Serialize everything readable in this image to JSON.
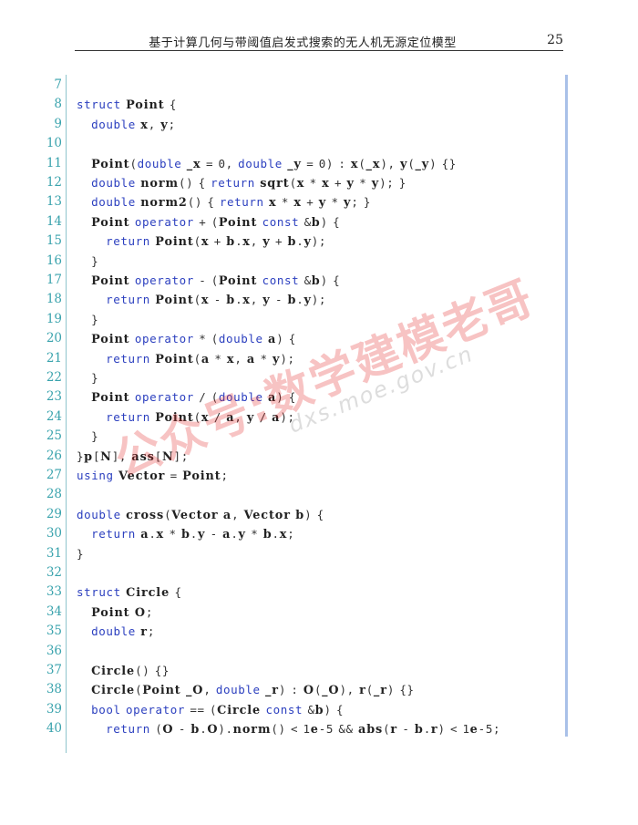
{
  "header": {
    "title": "基于计算几何与带阈值启发式搜索的无人机无源定位模型",
    "page_number": "25"
  },
  "code_lines": [
    {
      "n": "7",
      "text": ""
    },
    {
      "n": "8",
      "text": "struct Point {"
    },
    {
      "n": "9",
      "text": "   double x, y;"
    },
    {
      "n": "10",
      "text": ""
    },
    {
      "n": "11",
      "text": "   Point(double _x = 0, double _y = 0) : x(_x), y(_y) {}"
    },
    {
      "n": "12",
      "text": "   double norm() { return sqrt(x * x + y * y); }"
    },
    {
      "n": "13",
      "text": "   double norm2() { return x * x + y * y; }"
    },
    {
      "n": "14",
      "text": "   Point operator + (Point const &b) {"
    },
    {
      "n": "15",
      "text": "      return Point(x + b.x, y + b.y);"
    },
    {
      "n": "16",
      "text": "   }"
    },
    {
      "n": "17",
      "text": "   Point operator - (Point const &b) {"
    },
    {
      "n": "18",
      "text": "      return Point(x - b.x, y - b.y);"
    },
    {
      "n": "19",
      "text": "   }"
    },
    {
      "n": "20",
      "text": "   Point operator * (double a) {"
    },
    {
      "n": "21",
      "text": "      return Point(a * x, a * y);"
    },
    {
      "n": "22",
      "text": "   }"
    },
    {
      "n": "23",
      "text": "   Point operator / (double a) {"
    },
    {
      "n": "24",
      "text": "      return Point(x / a, y / a);"
    },
    {
      "n": "25",
      "text": "   }"
    },
    {
      "n": "26",
      "text": "}p[N], ass[N];"
    },
    {
      "n": "27",
      "text": "using Vector = Point;"
    },
    {
      "n": "28",
      "text": ""
    },
    {
      "n": "29",
      "text": "double cross(Vector a, Vector b) {"
    },
    {
      "n": "30",
      "text": "   return a.x * b.y - a.y * b.x;"
    },
    {
      "n": "31",
      "text": "}"
    },
    {
      "n": "32",
      "text": ""
    },
    {
      "n": "33",
      "text": "struct Circle {"
    },
    {
      "n": "34",
      "text": "   Point O;"
    },
    {
      "n": "35",
      "text": "   double r;"
    },
    {
      "n": "36",
      "text": ""
    },
    {
      "n": "37",
      "text": "   Circle() {}"
    },
    {
      "n": "38",
      "text": "   Circle(Point _O, double _r) : O(_O), r(_r) {}"
    },
    {
      "n": "39",
      "text": "   bool operator == (Circle const &b) {"
    },
    {
      "n": "40",
      "text": "      return (O - b.O).norm() < 1e-5 && abs(r - b.r) < 1e-5;"
    }
  ],
  "watermark": {
    "text": "公众号:数学建模老哥",
    "url": "dxs.moe.gov.cn"
  },
  "colors": {
    "keyword": "#2b3fbf",
    "line_number": "#3aa3ad",
    "text": "#222222",
    "watermark": "#e12828"
  }
}
